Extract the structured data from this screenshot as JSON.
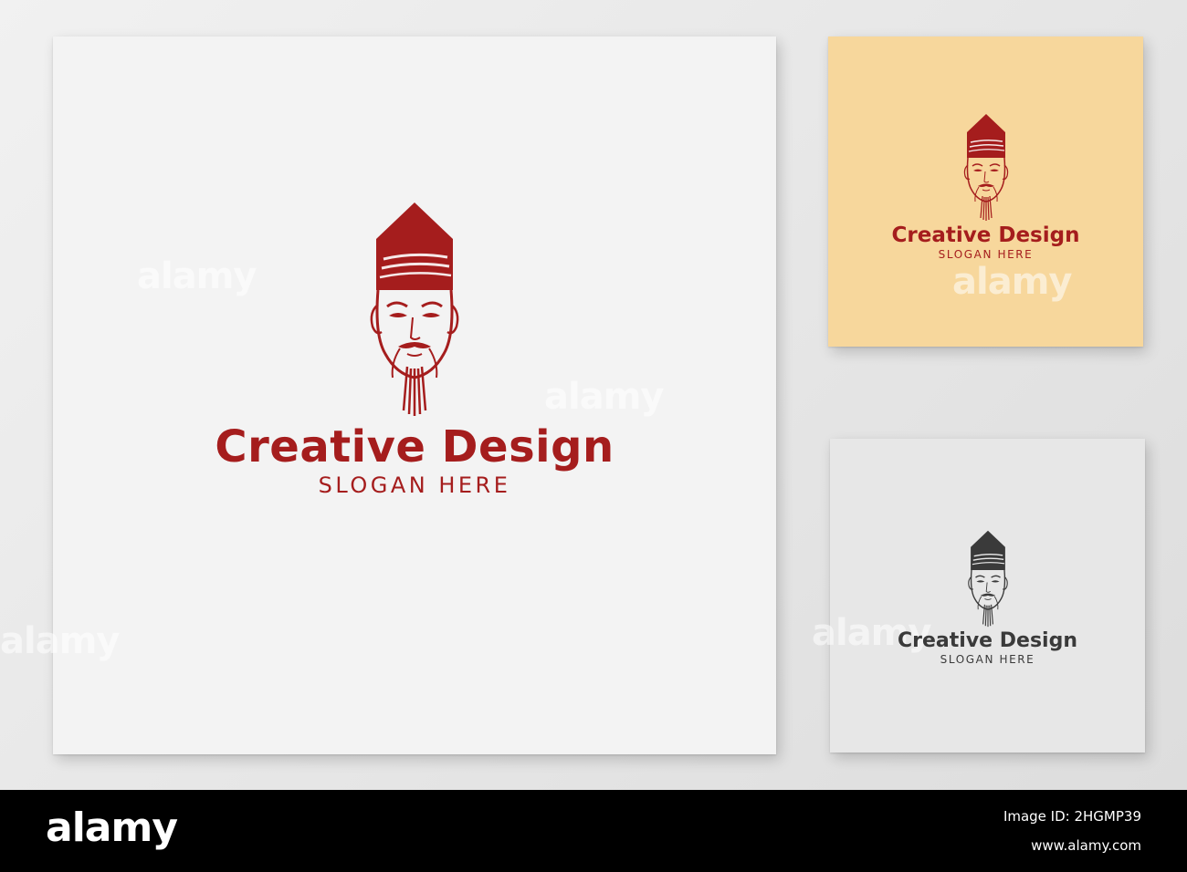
{
  "cards": {
    "main": {
      "brand": "Creative Design",
      "slogan": "SLOGAN HERE",
      "color": "#a51d1d",
      "background": "#f3f3f3"
    },
    "gold": {
      "brand": "Creative Design",
      "slogan": "SLOGAN HERE",
      "color": "#a51d1d",
      "background": "#f7d79c"
    },
    "gray": {
      "brand": "Creative Design",
      "slogan": "SLOGAN HERE",
      "color": "#3a3a3a",
      "background": "#e7e7e7"
    }
  },
  "logo_icon": "sage-face-icon",
  "watermark": "alamy",
  "footer": {
    "logo": "alamy",
    "image_id": "Image ID: 2HGMP39",
    "url": "www.alamy.com"
  }
}
